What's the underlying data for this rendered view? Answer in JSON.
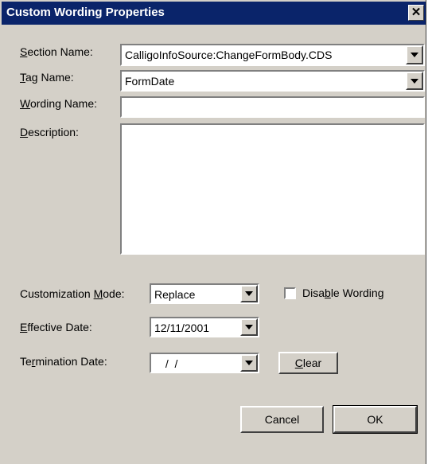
{
  "window": {
    "title": "Custom Wording Properties",
    "close_glyph": "✕"
  },
  "fields": {
    "section_name": {
      "label_pre": "",
      "label_key": "S",
      "label_post": "ection Name:",
      "value": "CalligoInfoSource:ChangeFormBody.CDS"
    },
    "tag_name": {
      "label_pre": "",
      "label_key": "T",
      "label_post": "ag Name:",
      "value": "FormDate"
    },
    "wording_name": {
      "label_pre": "",
      "label_key": "W",
      "label_post": "ording Name:",
      "value": ""
    },
    "description": {
      "label_pre": "",
      "label_key": "D",
      "label_post": "escription:",
      "value": ""
    },
    "customization_mode": {
      "label_pre": "Customization ",
      "label_key": "M",
      "label_post": "ode:",
      "value": "Replace"
    },
    "effective_date": {
      "label_pre": "",
      "label_key": "E",
      "label_post": "ffective Date:",
      "value": "12/11/2001"
    },
    "termination_date": {
      "label_pre": "Te",
      "label_key": "r",
      "label_post": "mination Date:",
      "value": " /  / "
    }
  },
  "disable_wording": {
    "label_pre": "Disa",
    "label_key": "b",
    "label_post": "le Wording",
    "checked": false
  },
  "buttons": {
    "clear": {
      "pre": "",
      "key": "C",
      "post": "lear"
    },
    "cancel": "Cancel",
    "ok": "OK"
  }
}
